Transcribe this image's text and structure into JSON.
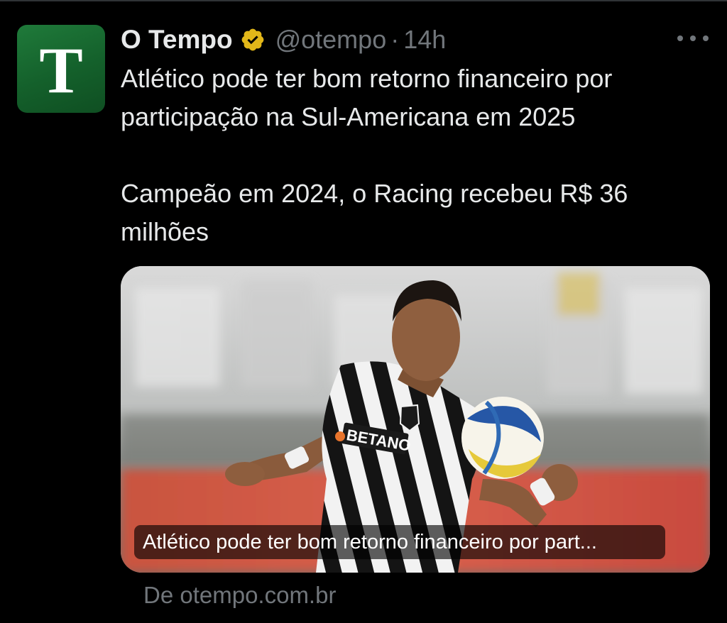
{
  "tweet": {
    "display_name": "O Tempo",
    "handle": "@otempo",
    "separator": "·",
    "time": "14h",
    "avatar_letter": "T",
    "verified": true,
    "text_paragraphs": [
      "Atlético pode ter bom retorno financeiro por participação na Sul-Americana em 2025",
      "Campeão em 2024, o Racing recebeu R$ 36 milhões"
    ],
    "more_icon": "more-horizontal-icon"
  },
  "link_card": {
    "image_subject": "football-player-photo",
    "sponsor_text": "BETANO",
    "caption": "Atlético pode ter bom retorno financeiro por part...",
    "source": "De otempo.com.br"
  },
  "colors": {
    "background": "#000000",
    "primary_text": "#e7e9ea",
    "secondary_text": "#71767b",
    "verified_gold": "#e2b719",
    "avatar_green": "#1a6e33"
  }
}
